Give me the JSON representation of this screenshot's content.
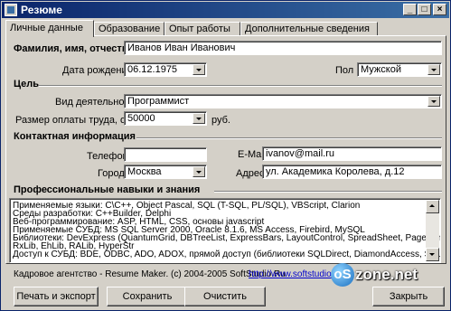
{
  "window": {
    "title": "Резюме"
  },
  "tabs": [
    "Личные данные",
    "Образование",
    "Опыт работы",
    "Дополнительные сведения"
  ],
  "personal": {
    "fio_label": "Фамилия, имя, отчество",
    "fio_value": "Иванов Иван Иванович",
    "dob_label": "Дата рождения",
    "dob_value": "06.12.1975",
    "gender_label": "Пол",
    "gender_value": "Мужской"
  },
  "goal": {
    "section_title": "Цель",
    "activity_label": "Вид деятельности",
    "activity_value": "Программист",
    "salary_label": "Размер оплаты труда, от",
    "salary_value": "50000",
    "salary_unit": "руб."
  },
  "contacts": {
    "section_title": "Контактная информация",
    "phone_label": "Телефон",
    "phone_value": "",
    "email_label": "E-Mail",
    "email_value": "ivanov@mail.ru",
    "city_label": "Город",
    "city_value": "Москва",
    "address_label": "Адрес",
    "address_value": "ул. Академика Королева, д.12"
  },
  "skills": {
    "section_title": "Профессиональные навыки и знания",
    "lines": [
      "Применяемые языки: C\\C++, Object Pascal, SQL (T-SQL, PL/SQL), VBScript, Clarion",
      "Среды разработки: C++Builder, Delphi",
      "Веб-программирование: ASP, HTML, CSS, основы javascript",
      "Применяемые СУБД: MS SQL Server 2000, Oracle 8.1.6, MS Access, Firebird, MySQL",
      "Библиотеки: DevExpress (QuantumGrid, DBTreeList, ExpressBars, LayoutControl, SpreadSheet, PageControl), FastReport,",
      "RxLib, EhLib, RALib, HyperStr",
      "Доступ к СУБД: BDE, ODBC, ADO, ADOX, прямой доступ (библиотеки SQLDirect, DiamondAccess, SQLQuery)"
    ]
  },
  "footer": {
    "credit": "Кадровое агентство - Resume Maker. (c) 2004-2005 SoftStudio.Ru",
    "link": "http://www.softstudio.ru"
  },
  "buttons": {
    "print": "Печать и экспорт",
    "save": "Сохранить",
    "clear": "Очистить",
    "close": "Закрыть"
  },
  "watermark": {
    "text": "zone.net",
    "circle": "oS"
  }
}
